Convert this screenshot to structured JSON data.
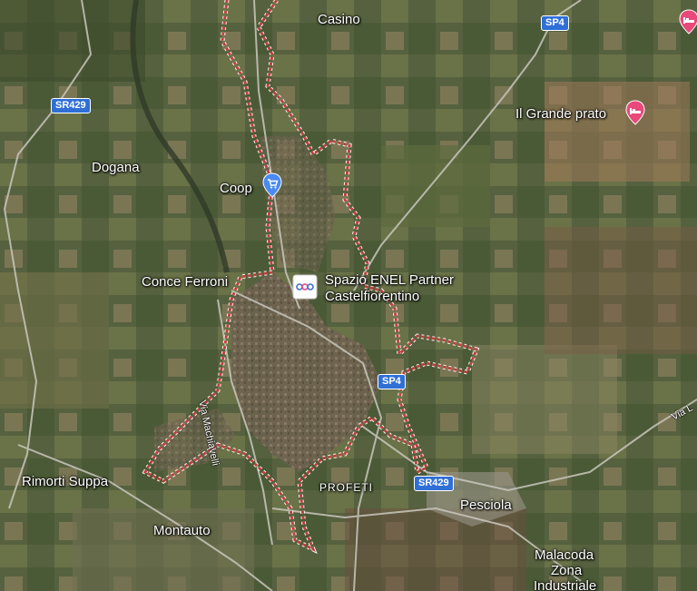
{
  "map": {
    "places": {
      "casino": "Casino",
      "dogana": "Dogana",
      "coop": "Coop",
      "conce_ferroni": "Conce Ferroni",
      "spazio_enel_1": "Spazio ENEL Partner",
      "spazio_enel_2": "Castelfiorentino",
      "rimorti_suppa": "Rimorti Suppa",
      "montauto": "Montauto",
      "profeti": "PROFETI",
      "pesciola": "Pesciola",
      "malacoda_1": "Malacoda",
      "malacoda_2": "Zona",
      "malacoda_3": "Industriale",
      "il_grande_prato": "Il Grande prato"
    },
    "roads": {
      "sr429_top": "SR429",
      "sr429_bottom": "SR429",
      "sp4_top": "SP4",
      "sp4_mid": "SP4",
      "via_machiavelli": "Via Machiavelli",
      "via_l": "Via L"
    },
    "colors": {
      "boundary": "#c73a3a",
      "shield": "#2f6fd6",
      "pin": "#e8487a",
      "shopping_pin": "#4a8af4"
    },
    "icons": {
      "shopping": "shopping-cart-icon",
      "lodging": "bed-icon",
      "enel": "enel-logo-icon"
    }
  }
}
